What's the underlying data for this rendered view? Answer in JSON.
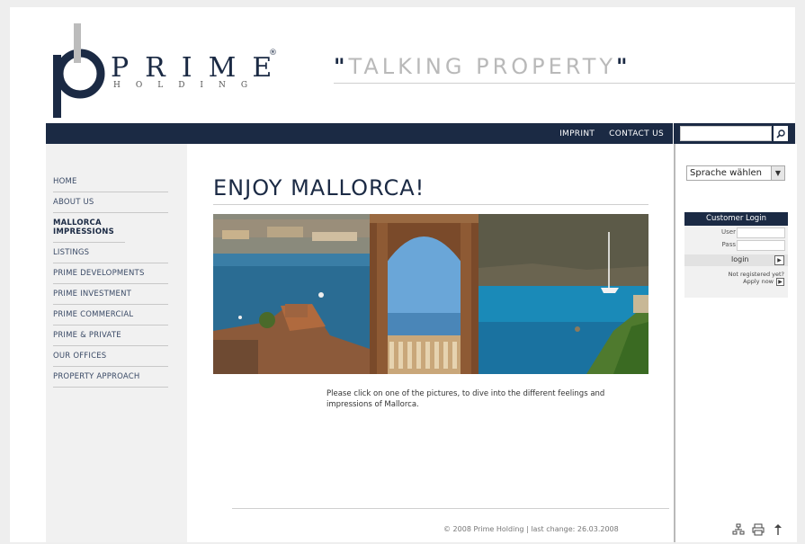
{
  "brand": {
    "name": "PRIME",
    "subname": "HOLDING",
    "registered": "®",
    "tagline": "TALKING PROPERTY",
    "quote_open": "\"",
    "quote_close": "\"",
    "color_navy": "#1b2a44"
  },
  "topnav": {
    "items": [
      {
        "label": "IMPRINT"
      },
      {
        "label": "CONTACT US"
      }
    ]
  },
  "search": {
    "value": "",
    "icon": "search-icon"
  },
  "sidebar": {
    "items": [
      {
        "label": "HOME",
        "active": false
      },
      {
        "label": "ABOUT US",
        "active": false
      },
      {
        "label": "MALLORCA IMPRESSIONS",
        "active": true
      },
      {
        "label": "LISTINGS",
        "active": false
      },
      {
        "label": "PRIME DEVELOPMENTS",
        "active": false
      },
      {
        "label": "PRIME INVESTMENT",
        "active": false
      },
      {
        "label": "PRIME COMMERCIAL",
        "active": false
      },
      {
        "label": "PRIME & PRIVATE",
        "active": false
      },
      {
        "label": "OUR OFFICES",
        "active": false
      },
      {
        "label": "PROPERTY APPROACH",
        "active": false
      }
    ]
  },
  "language": {
    "selected": "Sprache wählen"
  },
  "login": {
    "title": "Customer Login",
    "user_label": "User",
    "pass_label": "Pass",
    "button": "login",
    "not_registered": "Not registered yet?",
    "apply": "Apply now"
  },
  "main": {
    "heading": "ENJOY MALLORCA!",
    "photos": [
      {
        "name": "harbour-photo"
      },
      {
        "name": "arch-terrace-photo"
      },
      {
        "name": "bay-sailboat-photo"
      }
    ],
    "caption": "Please click on one of the pictures, to dive into the different feelings and impressions of Mallorca."
  },
  "footer": {
    "text": "© 2008 Prime Holding | last change: 26.03.2008"
  },
  "tools": [
    {
      "icon": "sitemap-icon"
    },
    {
      "icon": "print-icon"
    },
    {
      "icon": "arrow-up-icon"
    }
  ]
}
